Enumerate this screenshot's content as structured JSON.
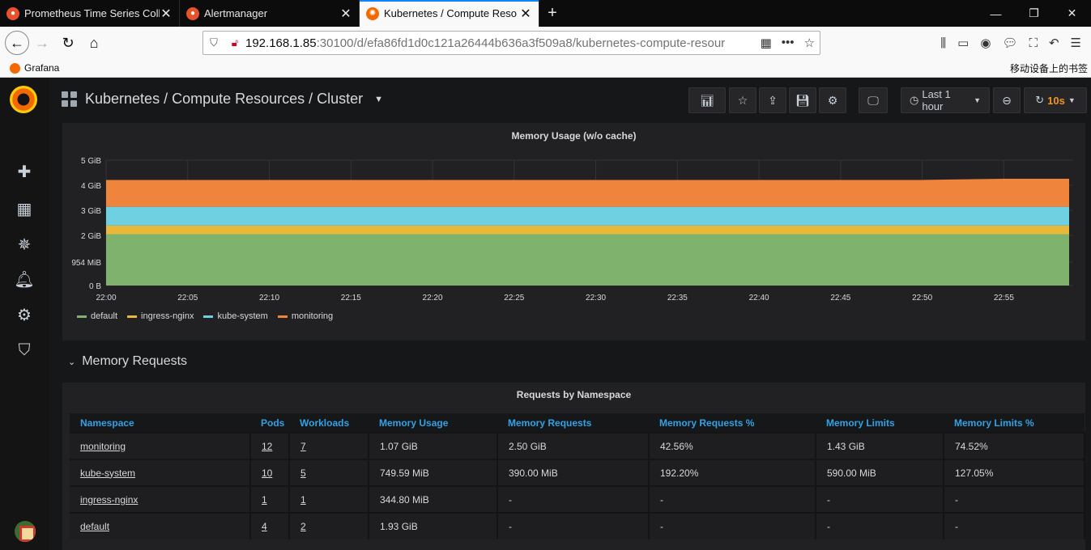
{
  "browser": {
    "tabs": [
      {
        "title": "Prometheus Time Series Coll",
        "active": false
      },
      {
        "title": "Alertmanager",
        "active": false
      },
      {
        "title": "Kubernetes / Compute Reso",
        "active": true
      }
    ],
    "url": {
      "host": "192.168.1.85",
      "path": ":30100/d/efa86fd1d0c121a26444b636a3f509a8/kubernetes-compute-resour"
    },
    "bookmarks": [
      {
        "label": "Grafana"
      }
    ],
    "mobile_bookmarks": "移动设备上的书签"
  },
  "dashboard": {
    "title": "Kubernetes / Compute Resources / Cluster",
    "time_range": "Last 1 hour",
    "refresh": "10s"
  },
  "memory_panel": {
    "title": "Memory Usage (w/o cache)",
    "legend": [
      {
        "name": "default",
        "color": "#7eb26d"
      },
      {
        "name": "ingress-nginx",
        "color": "#eab839"
      },
      {
        "name": "kube-system",
        "color": "#6ed0e0"
      },
      {
        "name": "monitoring",
        "color": "#ef843c"
      }
    ]
  },
  "chart_data": {
    "type": "area",
    "title": "Memory Usage (w/o cache)",
    "stacked": true,
    "x": [
      "22:00",
      "22:05",
      "22:10",
      "22:15",
      "22:20",
      "22:25",
      "22:30",
      "22:35",
      "22:40",
      "22:45",
      "22:50",
      "22:55",
      "22:59"
    ],
    "y_unit": "GiB",
    "ylim": [
      0,
      5
    ],
    "y_ticks": [
      "0 B",
      "954 MiB",
      "2 GiB",
      "3 GiB",
      "4 GiB",
      "5 GiB"
    ],
    "y_tick_values": [
      0,
      0.93,
      2,
      3,
      4,
      5
    ],
    "series": [
      {
        "name": "default",
        "color": "#7eb26d",
        "values": [
          2.05,
          2.05,
          2.05,
          2.05,
          2.05,
          2.05,
          2.05,
          2.05,
          2.05,
          2.05,
          2.05,
          2.05,
          2.05
        ]
      },
      {
        "name": "ingress-nginx",
        "color": "#eab839",
        "values": [
          0.34,
          0.34,
          0.34,
          0.34,
          0.34,
          0.34,
          0.34,
          0.34,
          0.34,
          0.34,
          0.34,
          0.34,
          0.34
        ]
      },
      {
        "name": "kube-system",
        "color": "#6ed0e0",
        "values": [
          0.75,
          0.75,
          0.75,
          0.75,
          0.75,
          0.75,
          0.75,
          0.75,
          0.75,
          0.75,
          0.75,
          0.75,
          0.75
        ]
      },
      {
        "name": "monitoring",
        "color": "#ef843c",
        "values": [
          1.07,
          1.07,
          1.07,
          1.07,
          1.07,
          1.07,
          1.07,
          1.07,
          1.07,
          1.07,
          1.07,
          1.12,
          1.12
        ]
      }
    ],
    "legend_position": "bottom-left",
    "grid": true
  },
  "row": {
    "title": "Memory Requests"
  },
  "requests_panel": {
    "title": "Requests by Namespace",
    "columns": [
      "Namespace",
      "Pods",
      "Workloads",
      "Memory Usage",
      "Memory Requests",
      "Memory Requests %",
      "Memory Limits",
      "Memory Limits %"
    ],
    "rows": [
      [
        "monitoring",
        "12",
        "7",
        "1.07 GiB",
        "2.50 GiB",
        "42.56%",
        "1.43 GiB",
        "74.52%"
      ],
      [
        "kube-system",
        "10",
        "5",
        "749.59 MiB",
        "390.00 MiB",
        "192.20%",
        "590.00 MiB",
        "127.05%"
      ],
      [
        "ingress-nginx",
        "1",
        "1",
        "344.80 MiB",
        "-",
        "-",
        "-",
        "-"
      ],
      [
        "default",
        "4",
        "2",
        "1.93 GiB",
        "-",
        "-",
        "-",
        "-"
      ]
    ]
  }
}
